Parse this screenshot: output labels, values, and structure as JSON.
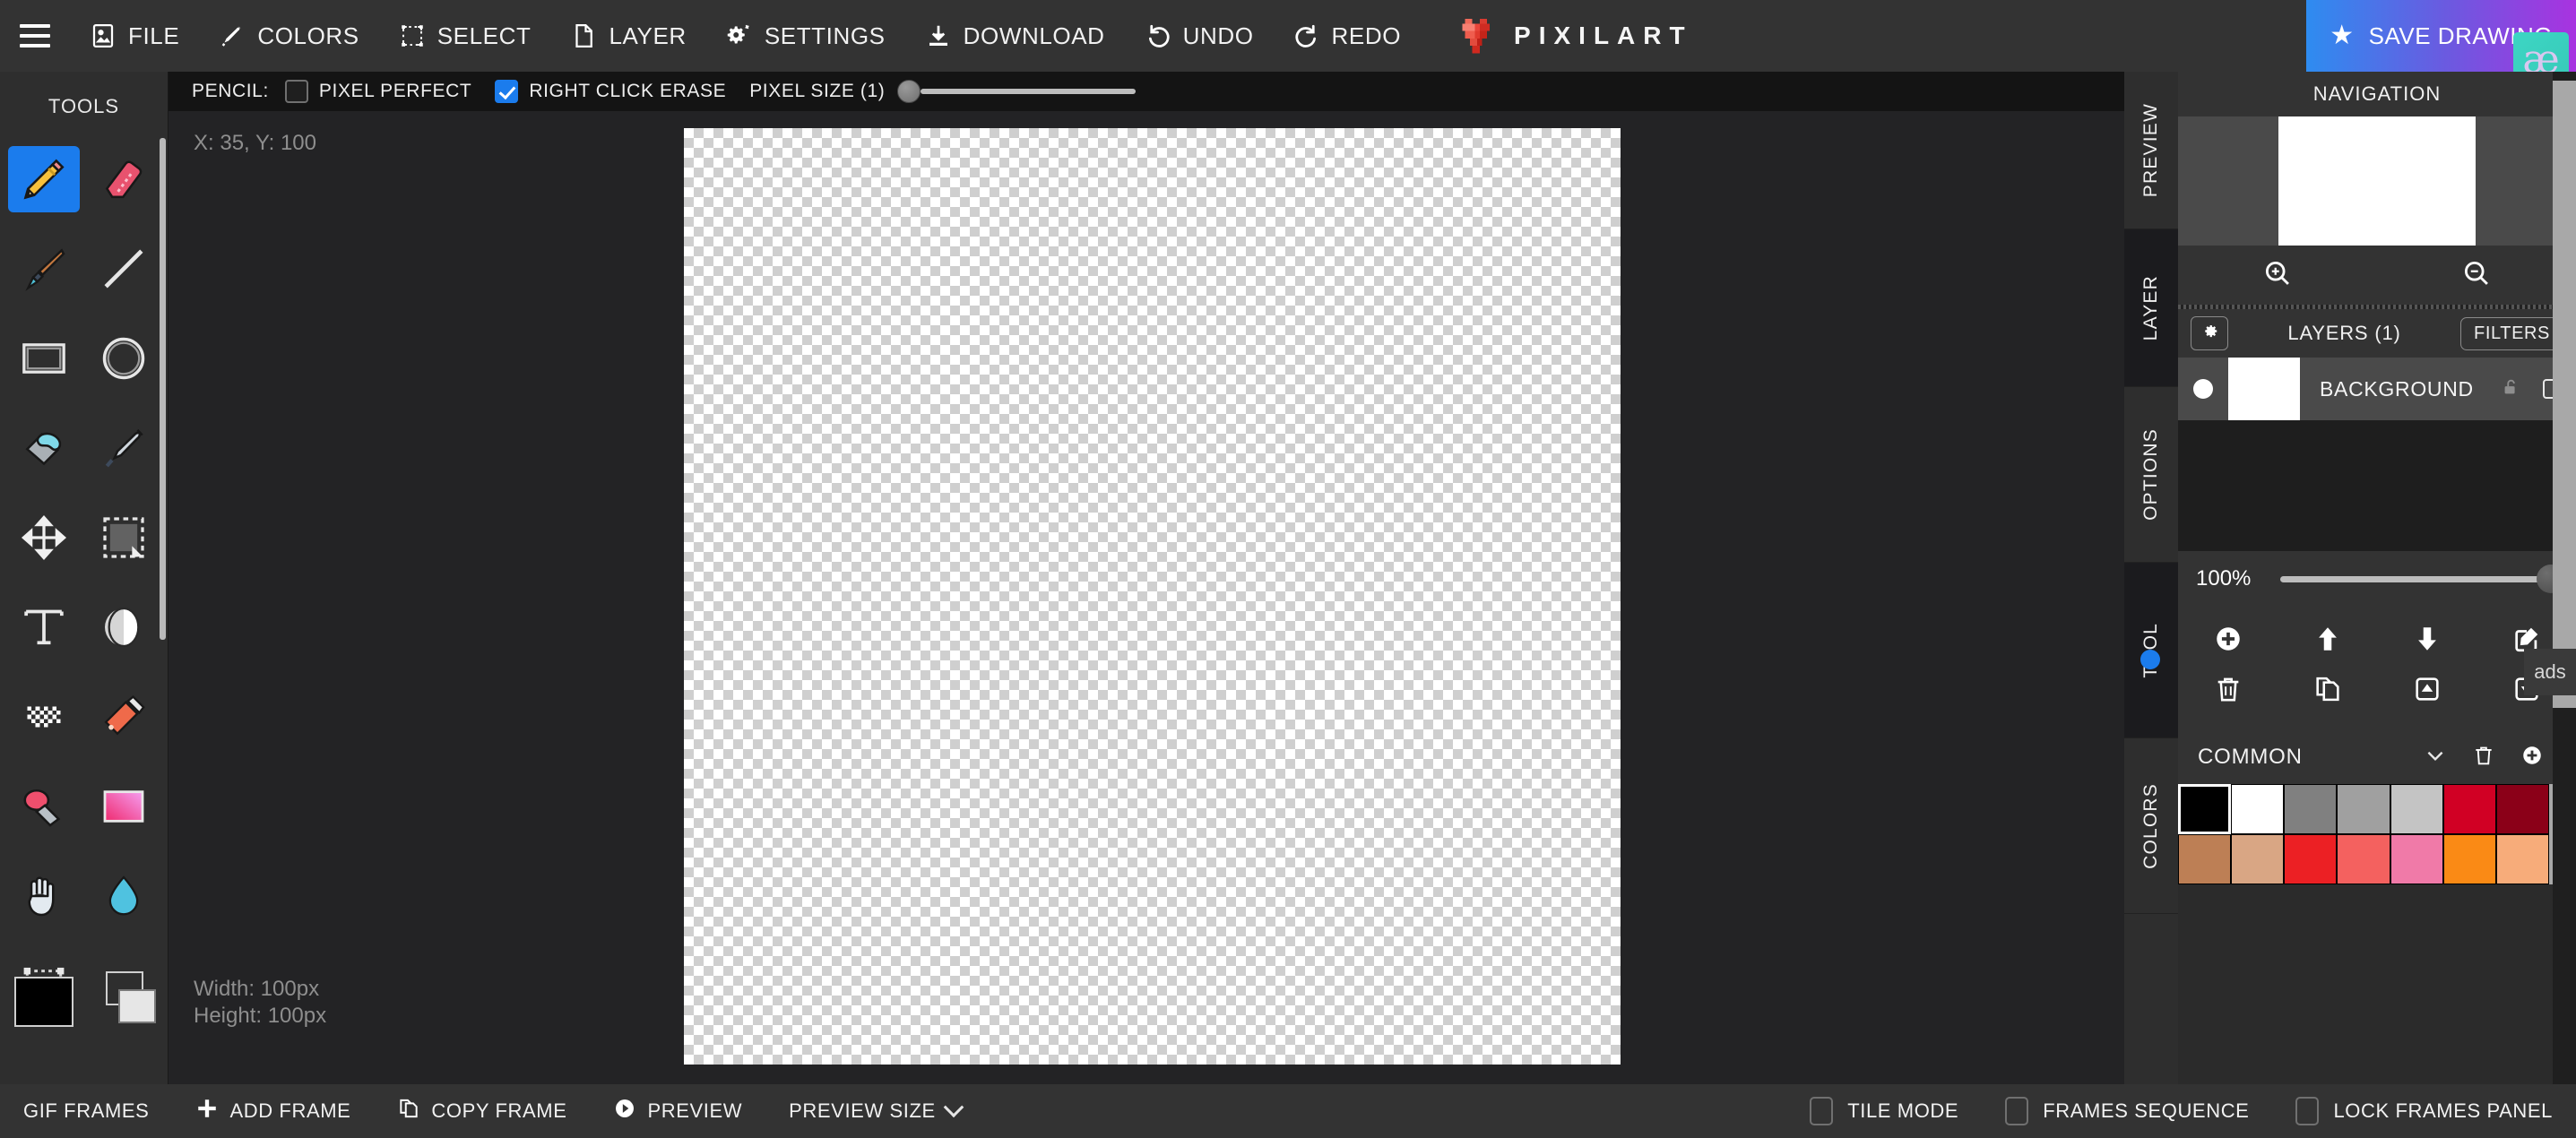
{
  "topbar": {
    "menu_icon": "hamburger-icon",
    "items": [
      {
        "label": "FILE",
        "icon": "file-image-icon"
      },
      {
        "label": "COLORS",
        "icon": "eyedropper-icon"
      },
      {
        "label": "SELECT",
        "icon": "selection-box-icon"
      },
      {
        "label": "LAYER",
        "icon": "page-icon"
      },
      {
        "label": "SETTINGS",
        "icon": "gears-icon"
      },
      {
        "label": "DOWNLOAD",
        "icon": "download-icon"
      },
      {
        "label": "UNDO",
        "icon": "undo-arrow-icon"
      },
      {
        "label": "REDO",
        "icon": "redo-arrow-icon"
      }
    ],
    "brand": "PIXILART",
    "brand_logo": "pixel-heart-icon",
    "save_label": "SAVE DRAWING",
    "save_icon": "star-icon",
    "widget_label": "æ"
  },
  "tools": {
    "title": "TOOLS",
    "items": [
      {
        "name": "pencil",
        "icon": "pencil-icon",
        "active": true
      },
      {
        "name": "eraser",
        "icon": "eraser-icon",
        "active": false
      },
      {
        "name": "paintbrush",
        "icon": "paintbrush-icon",
        "active": false
      },
      {
        "name": "line",
        "icon": "line-icon",
        "active": false
      },
      {
        "name": "rectangle",
        "icon": "rectangle-icon",
        "active": false
      },
      {
        "name": "ellipse",
        "icon": "ellipse-icon",
        "active": false
      },
      {
        "name": "paint-bucket",
        "icon": "paint-bucket-icon",
        "active": false
      },
      {
        "name": "color-picker",
        "icon": "eyedropper-icon",
        "active": false
      },
      {
        "name": "move",
        "icon": "move-arrows-icon",
        "active": false
      },
      {
        "name": "select-area",
        "icon": "marquee-select-icon",
        "active": false
      },
      {
        "name": "text",
        "icon": "text-t-icon",
        "active": false
      },
      {
        "name": "shading",
        "icon": "shading-sphere-icon",
        "active": false
      },
      {
        "name": "dither",
        "icon": "dither-pattern-icon",
        "active": false
      },
      {
        "name": "spray",
        "icon": "spray-can-icon",
        "active": false
      },
      {
        "name": "lighten",
        "icon": "lighten-icon",
        "active": false
      },
      {
        "name": "gradient",
        "icon": "gradient-icon",
        "active": false
      },
      {
        "name": "pan",
        "icon": "hand-icon",
        "active": false
      },
      {
        "name": "smudge",
        "icon": "water-drop-icon",
        "active": false
      },
      {
        "name": "crop",
        "icon": "crop-dotted-icon",
        "active": false
      }
    ],
    "primary_color": "#000000",
    "secondary_color": "#ffffff"
  },
  "options": {
    "tool_label": "PENCIL:",
    "pixel_perfect_label": "PIXEL PERFECT",
    "pixel_perfect_checked": false,
    "right_click_erase_label": "RIGHT CLICK ERASE",
    "right_click_erase_checked": true,
    "pixel_size_label": "PIXEL SIZE (1)",
    "pixel_size_value": 1
  },
  "canvas": {
    "coords": "X: 35, Y: 100",
    "width_text": "Width: 100px",
    "height_text": "Height: 100px"
  },
  "right_panel": {
    "vtabs": [
      {
        "label": "PREVIEW",
        "active": false
      },
      {
        "label": "LAYER",
        "active": true
      },
      {
        "label": "OPTIONS",
        "active": false
      },
      {
        "label": "TOOL",
        "active": true,
        "dot": true
      },
      {
        "label": "COLORS",
        "active": false
      }
    ],
    "navigation_title": "NAVIGATION",
    "zoom_in_icon": "zoom-in-icon",
    "zoom_out_icon": "zoom-out-icon",
    "layers": {
      "title": "LAYERS (1)",
      "settings_icon": "gear-icon",
      "filters_label": "FILTERS",
      "rows": [
        {
          "name": "BACKGROUND",
          "visible": true,
          "locked": false,
          "selected": false
        }
      ],
      "opacity_label": "100%",
      "opacity_value": 100,
      "actions_row1": [
        {
          "name": "add-layer",
          "icon": "plus-circle-icon"
        },
        {
          "name": "move-layer-up",
          "icon": "arrow-up-icon"
        },
        {
          "name": "move-layer-down",
          "icon": "arrow-down-icon"
        },
        {
          "name": "rename-layer",
          "icon": "edit-pencil-icon"
        }
      ],
      "actions_row2": [
        {
          "name": "delete-layer",
          "icon": "trash-icon"
        },
        {
          "name": "duplicate-layer",
          "icon": "copy-icon"
        },
        {
          "name": "merge-up",
          "icon": "merge-up-icon"
        },
        {
          "name": "merge-down",
          "icon": "merge-down-icon"
        }
      ]
    },
    "palette": {
      "name": "COMMON",
      "dropdown_icon": "chevron-down-icon",
      "delete_icon": "trash-icon",
      "add_icon": "plus-circle-icon",
      "swatches_row1": [
        "#000000",
        "#ffffff",
        "#808080",
        "#a0a0a0",
        "#c4c4c4",
        "#d10024",
        "#8b0018"
      ],
      "swatches_row2": [
        "#bd7f55",
        "#d9a684",
        "#ec2024",
        "#f4615f",
        "#f07aa8",
        "#fa8a15",
        "#f7ac7a"
      ],
      "selected_swatch": "#000000"
    },
    "ads_label": "ads"
  },
  "bottombar": {
    "left_items": [
      {
        "label": "GIF FRAMES",
        "icon": "none"
      },
      {
        "label": "ADD FRAME",
        "icon": "plus-icon"
      },
      {
        "label": "COPY FRAME",
        "icon": "copy-icon"
      },
      {
        "label": "PREVIEW",
        "icon": "play-circle-icon"
      },
      {
        "label": "PREVIEW SIZE",
        "icon": "chevron-down-icon"
      }
    ],
    "right_checkboxes": [
      {
        "label": "TILE MODE",
        "checked": false
      },
      {
        "label": "FRAMES SEQUENCE",
        "checked": false
      },
      {
        "label": "LOCK FRAMES PANEL",
        "checked": false
      }
    ]
  }
}
